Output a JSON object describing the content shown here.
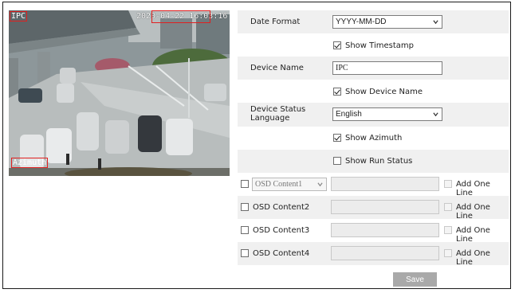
{
  "preview": {
    "timestamp": "2020-04-22 16:03:16",
    "device_name": "IPC",
    "azimuth": "Azimuth"
  },
  "settings": {
    "date_format": {
      "label": "Date Format",
      "value": "YYYY-MM-DD"
    },
    "show_timestamp": {
      "label": "Show Timestamp",
      "checked": true
    },
    "device_name": {
      "label": "Device Name",
      "value": "IPC"
    },
    "show_device_name": {
      "label": "Show Device Name",
      "checked": true
    },
    "device_status_language": {
      "label_line1": "Device Status",
      "label_line2": "Language",
      "value": "English"
    },
    "show_azimuth": {
      "label": "Show Azimuth",
      "checked": true
    },
    "show_run_status": {
      "label": "Show Run Status",
      "checked": false
    }
  },
  "osd_contents": [
    {
      "label": "OSD Content1",
      "checked": false,
      "dropdown": true,
      "add_one_line": "Add One Line"
    },
    {
      "label": "OSD Content2",
      "checked": false,
      "dropdown": false,
      "add_one_line": "Add One Line"
    },
    {
      "label": "OSD Content3",
      "checked": false,
      "dropdown": false,
      "add_one_line": "Add One Line"
    },
    {
      "label": "OSD Content4",
      "checked": false,
      "dropdown": false,
      "add_one_line": "Add One Line"
    }
  ],
  "save_label": "Save",
  "colors": {
    "osd_box": "#e02020",
    "row_shade": "#f0f0f0",
    "save_button": "#a9a9a9"
  }
}
